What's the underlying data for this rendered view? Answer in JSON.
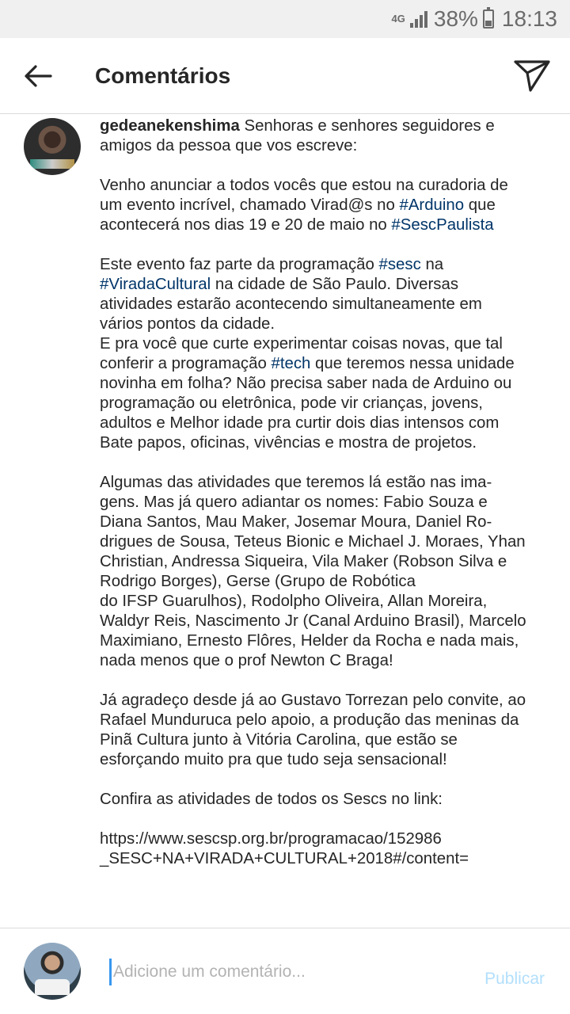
{
  "status_bar": {
    "network": "4G",
    "battery": "38%",
    "battery_level": 0.38,
    "time": "18:13"
  },
  "header": {
    "title": "Comentários",
    "back_icon": "arrow-left-icon",
    "direct_icon": "paper-plane-icon"
  },
  "comment": {
    "username": "gedeanekenshima",
    "intro": "Senhoras e senhores seguidores e amigos da pessoa que vos escreve:",
    "p2_a": "Venho anunciar a todos vocês que estou na curadoria de um evento incrível, chamado Virad@s no ",
    "tag_arduino": "#Arduino",
    "p2_b": " que acontecerá nos dias 19 e 20 de maio no ",
    "tag_sescpaulista": "#SescPaulista",
    "p3_a": "Este evento faz parte da programação ",
    "tag_sesc": "#sesc",
    "p3_b": " na ",
    "tag_viradacultural": "#ViradaCultural",
    "p3_c": " na cidade de São Paulo. Diversas atividades estarão acontecendo simultaneamente em vários pontos da cidade.\nE pra você que curte experimentar coisas novas, que tal conferir a programação ",
    "tag_tech": "#tech",
    "p3_d": " que teremos nessa unidade novinha em folha? Não precisa saber nada de Arduino ou programação ou eletrônica, pode vir crianças, jovens, adultos e Melhor idade pra curtir dois dias intensos com Bate papos, oficinas, vivências e mostra de projetos.",
    "p4": "Algumas das atividades que teremos lá estão nas ima-\ngens. Mas já quero adiantar os nomes: Fabio Souza e Diana Santos, Mau Maker, Josemar Moura, Daniel Ro-\ndrigues de Sousa, Teteus Bionic e Michael J. Moraes, Yhan Christian, Andressa Siqueira, Vila Maker (Robson Silva e Rodrigo Borges), Gerse (Grupo de Robótica\ndo IFSP Guarulhos), Rodolpho Oliveira, Allan Moreira, Waldyr Reis, Nascimento Jr (Canal Arduino Brasil), Marcelo Maximiano, Ernesto Flôres, Helder da Rocha e nada mais, nada menos que o prof Newton C Braga!",
    "p5": "Já agradeço desde já ao Gustavo Torrezan pelo convite, ao Rafael Munduruca pelo apoio, a produção das meninas da Pinã Cultura junto à Vitória Carolina, que estão se esforçando muito pra que tudo seja sensacional!",
    "p6": "Confira as atividades de todos os Sescs no link:",
    "p7": "https://www.sescsp.org.br/programacao/152986\n_SESC+NA+VIRADA+CULTURAL+2018#/content="
  },
  "composer": {
    "placeholder": "Adicione um comentário...",
    "publish_label": "Publicar"
  },
  "colors": {
    "hashtag": "#003569",
    "publish_disabled": "#b2dffc",
    "caret": "#3897f0"
  }
}
